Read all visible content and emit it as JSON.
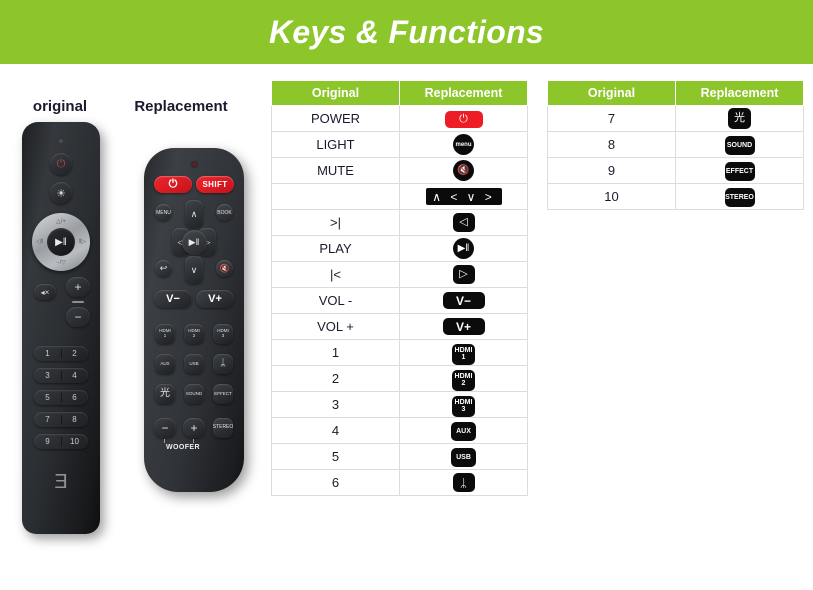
{
  "header": {
    "title": "Keys & Functions"
  },
  "labels": {
    "original_remote": "original",
    "replacement_remote": "Replacement"
  },
  "colors": {
    "brand_green": "#8CC62B",
    "power_red": "#EE1C25",
    "key_black": "#0B0B0B",
    "text_dark": "#1A1A2E",
    "border_gray": "#DCDCDC"
  },
  "tables": {
    "main": {
      "columns": [
        "Original",
        "Replacement"
      ],
      "rows": [
        {
          "original": "POWER",
          "replacement_label": "⏻",
          "replacement_icon": "power-icon",
          "style": "power"
        },
        {
          "original": "LIGHT",
          "replacement_label": "menu",
          "replacement_icon": "menu-icon",
          "style": "circle"
        },
        {
          "original": "MUTE",
          "replacement_label": "🔇",
          "replacement_icon": "mute-icon",
          "style": "circle-big"
        },
        {
          "original": "",
          "replacement_label": "∧ < ∨ >",
          "replacement_icon": "navigation-arrows-icon",
          "style": "nav"
        },
        {
          "original": ">|",
          "replacement_label": "◁",
          "replacement_icon": "rewind-icon",
          "style": "square"
        },
        {
          "original": "PLAY",
          "replacement_label": "▶‖",
          "replacement_icon": "play-pause-icon",
          "style": "circle-big"
        },
        {
          "original": "|<",
          "replacement_label": "▷",
          "replacement_icon": "fast-forward-icon",
          "style": "square"
        },
        {
          "original": "VOL -",
          "replacement_label": "V−",
          "replacement_icon": "volume-down-icon",
          "style": "vol"
        },
        {
          "original": "VOL +",
          "replacement_label": "V+",
          "replacement_icon": "volume-up-icon",
          "style": "vol"
        },
        {
          "original": "1",
          "replacement_label": "HDMI",
          "replacement_sub": "1",
          "replacement_icon": "hdmi-1-icon",
          "style": "hdmi"
        },
        {
          "original": "2",
          "replacement_label": "HDMI",
          "replacement_sub": "2",
          "replacement_icon": "hdmi-2-icon",
          "style": "hdmi"
        },
        {
          "original": "3",
          "replacement_label": "HDMI",
          "replacement_sub": "3",
          "replacement_icon": "hdmi-3-icon",
          "style": "hdmi"
        },
        {
          "original": "4",
          "replacement_label": "AUX",
          "replacement_icon": "aux-icon",
          "style": "text"
        },
        {
          "original": "5",
          "replacement_label": "USB",
          "replacement_icon": "usb-icon",
          "style": "text"
        },
        {
          "original": "6",
          "replacement_label": "ᛦ",
          "replacement_icon": "bluetooth-icon",
          "style": "bluetooth"
        }
      ]
    },
    "extra": {
      "columns": [
        "Original",
        "Replacement"
      ],
      "rows": [
        {
          "original": "7",
          "replacement_label": "光",
          "replacement_icon": "light-icon",
          "style": "light"
        },
        {
          "original": "8",
          "replacement_label": "SOUND",
          "replacement_icon": "sound-icon",
          "style": "text-wide"
        },
        {
          "original": "9",
          "replacement_label": "EFFECT",
          "replacement_icon": "effect-icon",
          "style": "text-wide"
        },
        {
          "original": "10",
          "replacement_label": "STEREO",
          "replacement_icon": "stereo-icon",
          "style": "text-wide"
        }
      ]
    }
  },
  "remote_original": {
    "power": "⏻",
    "light": "☀",
    "dpad_up": "△/+",
    "dpad_down": "−/▽",
    "dpad_left": "◁‖",
    "dpad_right": "‖▷",
    "play": "▶‖",
    "mute": "◂×",
    "vol_up": "+",
    "vol_down": "−",
    "numbers": [
      [
        "1",
        "2"
      ],
      [
        "3",
        "4"
      ],
      [
        "5",
        "6"
      ],
      [
        "7",
        "8"
      ],
      [
        "9",
        "10"
      ]
    ],
    "logo": "Ǝ"
  },
  "remote_replacement": {
    "power": "⏻",
    "shift": "SHIFT",
    "menu": "MENU",
    "book": "BOOK",
    "up": "∧",
    "down": "∨",
    "left": "◁",
    "right": "▷",
    "ok": "▶‖",
    "back": "↩",
    "mute": "🔇",
    "vol_down": "V−",
    "vol_up": "V+",
    "hdmi1_label": "HDMI",
    "hdmi1_sub": "1",
    "hdmi2_label": "HDMI",
    "hdmi2_sub": "2",
    "hdmi3_label": "HDMI",
    "hdmi3_sub": "3",
    "aux": "AUX",
    "usb": "USB",
    "bluetooth": "ᛦ",
    "light": "光",
    "sound": "SOUND",
    "effect": "EFFECT",
    "stereo": "STEREO",
    "woofer_minus": "−",
    "woofer_plus": "+",
    "woofer_label": "WOOFER"
  }
}
